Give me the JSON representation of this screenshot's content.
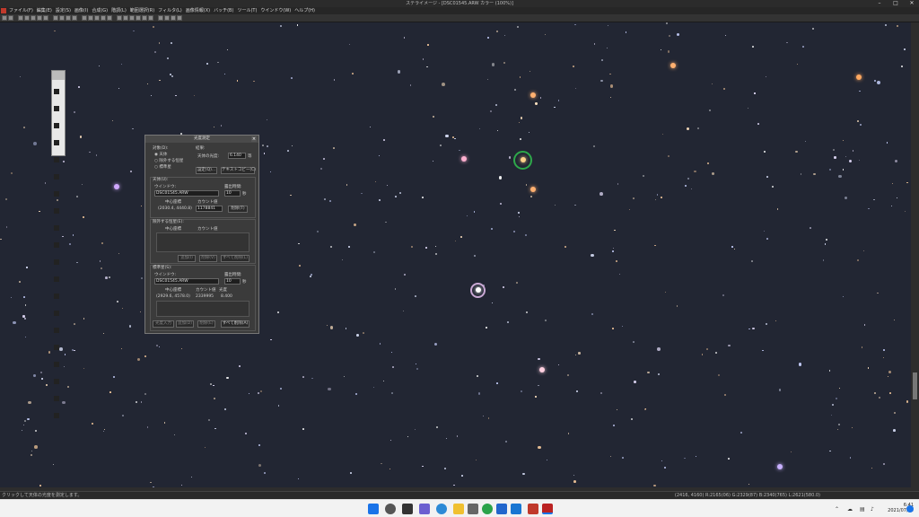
{
  "window": {
    "title": "ステライメージ - [DSC01545.ARW カラー (100%)]"
  },
  "menu": [
    "ファイル(F)",
    "編集(E)",
    "設定(S)",
    "画像(I)",
    "合成(G)",
    "階調(L)",
    "範囲選択(R)",
    "フィルタ(L)",
    "画像情報(X)",
    "バッチ(B)",
    "ツール(T)",
    "ウインドウ(W)",
    "ヘルプ(H)"
  ],
  "dialog": {
    "title": "光度測定",
    "target_label": "対象(D):",
    "target_opts": [
      "天体",
      "除外する恒星",
      "標準星"
    ],
    "result_label": "結果:",
    "mag_label": "天体の光度:",
    "mag_value": "6.140",
    "mag_unit": "等",
    "settings_btn": "設定(Q)...",
    "copy_btn": "テキストコピー(C)",
    "obj_label": "天体(U):",
    "window_label": "ウインドウ:",
    "obj_window": "DSC01545.ARW",
    "exp_label": "露出時間:",
    "obj_exp": "10",
    "sec": "秒",
    "center_label": "中心座標",
    "count_label": "カウント値",
    "obj_coord": "(2030.4, 4440.8)",
    "obj_count": "1178841",
    "delete_btn": "削除(T)",
    "exclude_label": "除外する恒星(E):",
    "add_btn": "追加(I)",
    "remove_btn": "削除(V)",
    "clear_btn": "すべて削除(L)",
    "std_label": "標準星(S):",
    "std_window": "DSC01545.ARW",
    "std_exp": "10",
    "mag_col": "光度",
    "std_coord": "(2929.6, 4578.0)",
    "std_count": "2339995",
    "std_mag": "8.400",
    "btn_std_input": "光度入力",
    "btn_std_add": "追加(D)",
    "btn_std_del": "削除(E)",
    "btn_std_clear": "すべて削除(A)"
  },
  "status": {
    "left": "クリックして天体の光度を測定します。",
    "right": "(2416, 4160) R:2165(06) G:2329(87) B:2340(765) L:2621(580.0)"
  },
  "clock": {
    "time": "6:41",
    "date": "2021/07/20"
  }
}
